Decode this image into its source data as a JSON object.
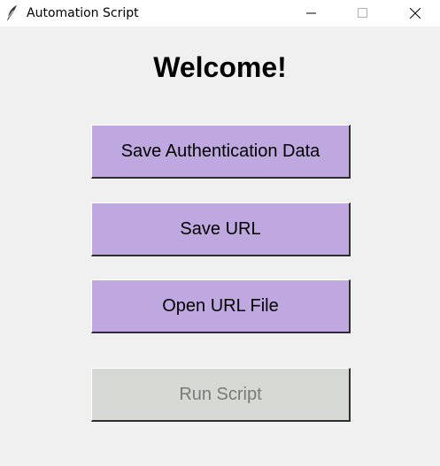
{
  "window": {
    "title": "Automation Script",
    "controls": {
      "minimize_icon": "minimize-icon",
      "maximize_icon": "maximize-icon",
      "close_icon": "close-icon"
    }
  },
  "main": {
    "heading": "Welcome!",
    "buttons": [
      {
        "label": "Save Authentication Data",
        "enabled": true
      },
      {
        "label": "Save URL",
        "enabled": true
      },
      {
        "label": "Open URL File",
        "enabled": true
      },
      {
        "label": "Run Script",
        "enabled": false
      }
    ]
  },
  "colors": {
    "button_bg": "#bfa8df",
    "disabled_bg": "#d5d8d3",
    "disabled_text": "#7a7a7a",
    "window_bg": "#f0f0f0"
  }
}
